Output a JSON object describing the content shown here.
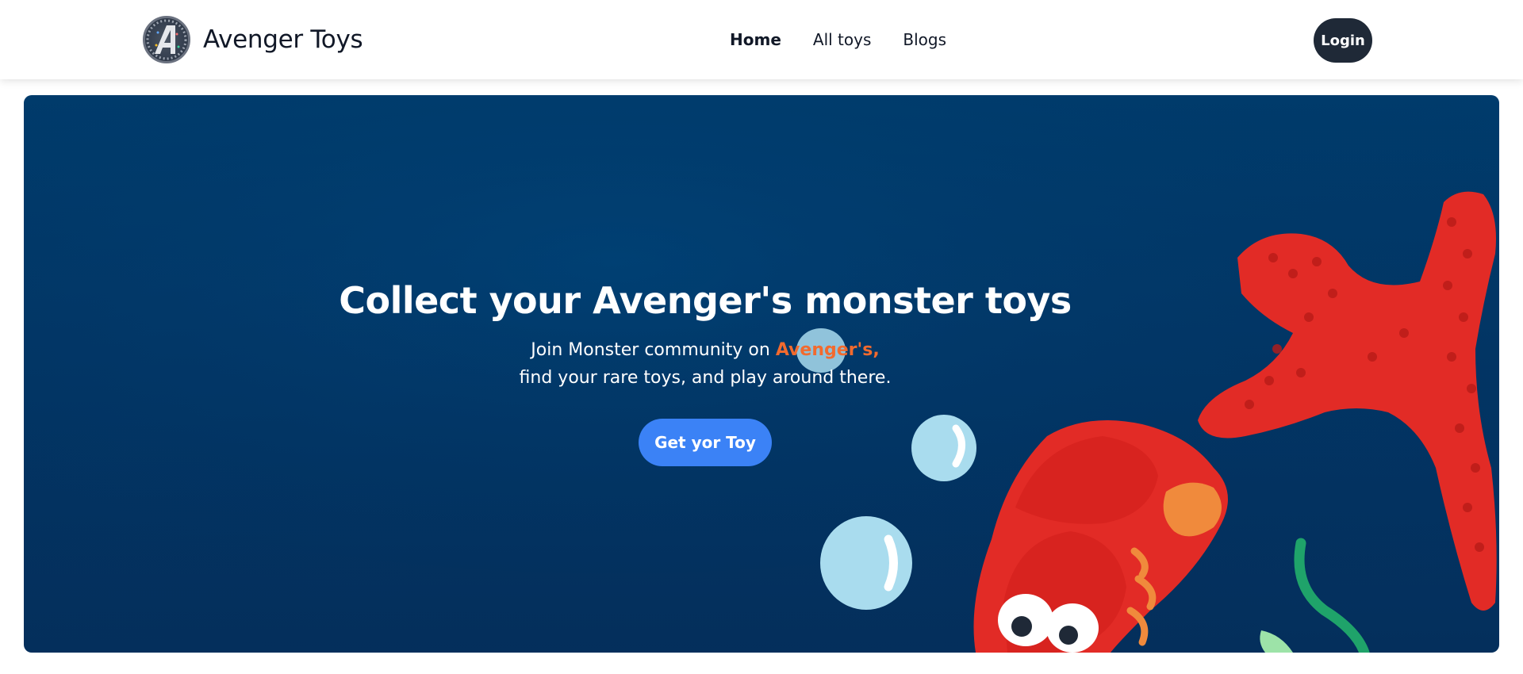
{
  "nav": {
    "brand_name": "Avenger Toys",
    "links": [
      {
        "label": "Home",
        "active": true
      },
      {
        "label": "All toys",
        "active": false
      },
      {
        "label": "Blogs",
        "active": false
      }
    ],
    "login_label": "Login"
  },
  "hero": {
    "title": "Collect your Avenger's monster toys",
    "subtitle_prefix": "Join Monster community on",
    "subtitle_accent": "Avenger's,",
    "subtitle_line2": "find your rare toys, and play around there.",
    "cta_label": "Get yor Toy"
  },
  "colors": {
    "hero_background": "#023666",
    "accent": "#f26a2e",
    "cta": "#3b82f6",
    "login": "#1f2937"
  },
  "icons": {
    "brand_logo": "avengers-logo-icon"
  }
}
